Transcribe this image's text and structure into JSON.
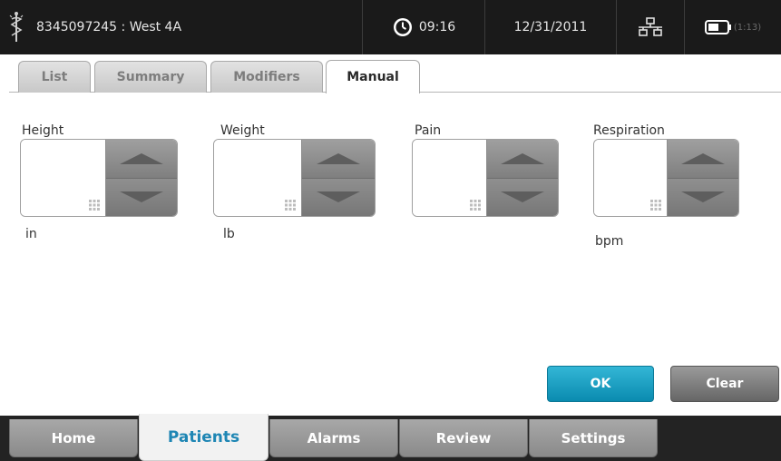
{
  "header": {
    "patient_id": "8345097245 : West 4A",
    "time": "09:16",
    "date": "12/31/2011",
    "battery_time": "(1:13)",
    "icons": [
      "caduceus-icon",
      "clock-icon",
      "network-icon",
      "battery-icon"
    ]
  },
  "tabs": [
    {
      "label": "List"
    },
    {
      "label": "Summary"
    },
    {
      "label": "Modifiers"
    },
    {
      "label": "Manual",
      "active": true
    }
  ],
  "fields": [
    {
      "label": "Height",
      "value": "",
      "unit": "in"
    },
    {
      "label": "Weight",
      "value": "",
      "unit": "lb"
    },
    {
      "label": "Pain",
      "value": "",
      "unit": ""
    },
    {
      "label": "Respiration",
      "value": "",
      "unit": "bpm"
    }
  ],
  "buttons": {
    "ok": "OK",
    "clear": "Clear"
  },
  "nav": [
    {
      "label": "Home"
    },
    {
      "label": "Patients",
      "active": true
    },
    {
      "label": "Alarms"
    },
    {
      "label": "Review"
    },
    {
      "label": "Settings"
    }
  ],
  "colors": {
    "accent": "#1e86b4",
    "ok_button": "#17a1c6",
    "header_bg": "#1a1a1a"
  }
}
